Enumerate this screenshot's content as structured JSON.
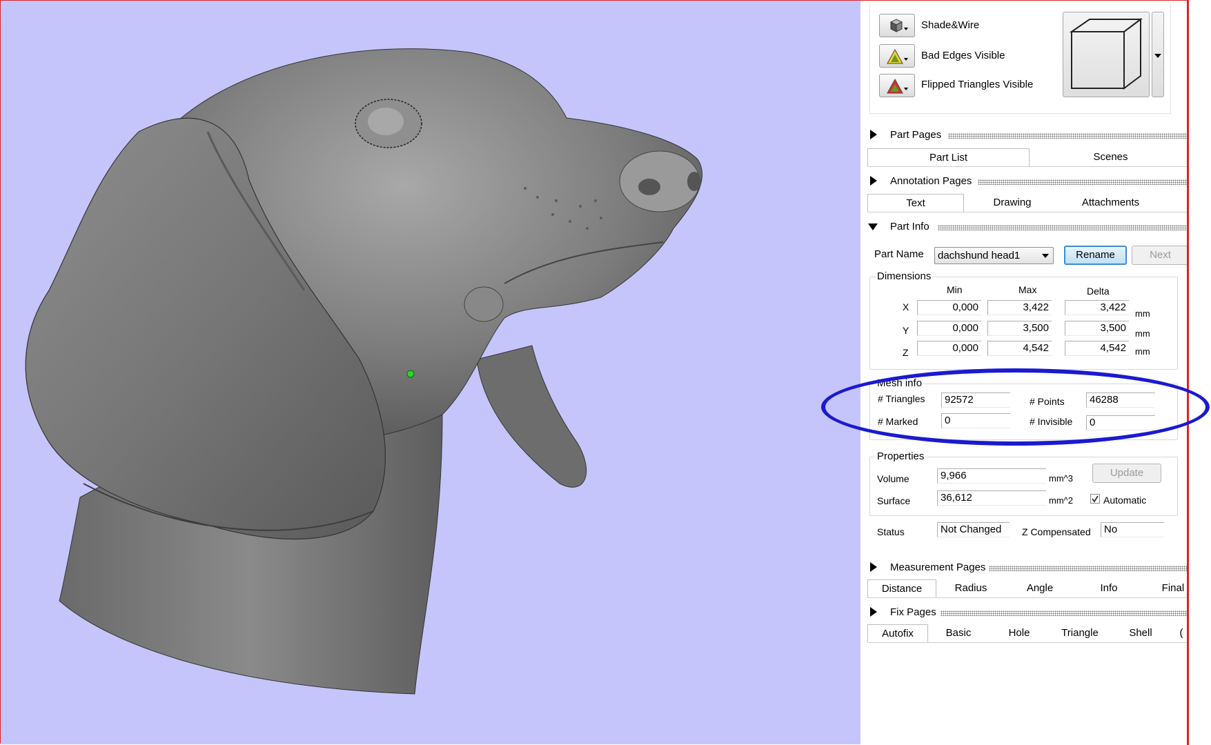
{
  "display": {
    "shade_wire": "Shade&Wire",
    "bad_edges": "Bad Edges Visible",
    "flipped_triangles": "Flipped Triangles Visible"
  },
  "sections": {
    "part_pages": "Part Pages",
    "annotation_pages": "Annotation Pages",
    "part_info": "Part Info",
    "measurement_pages": "Measurement Pages",
    "fix_pages": "Fix Pages"
  },
  "part_tabs": [
    "Part List",
    "Scenes"
  ],
  "annotation_tabs": [
    "Text",
    "Drawing",
    "Attachments"
  ],
  "measurement_tabs": [
    "Distance",
    "Radius",
    "Angle",
    "Info",
    "Final P"
  ],
  "fix_tabs": [
    "Autofix",
    "Basic",
    "Hole",
    "Triangle",
    "Shell",
    "("
  ],
  "part_info": {
    "part_name_label": "Part Name",
    "part_name_value": "dachshund head1",
    "rename": "Rename",
    "next": "Next"
  },
  "dimensions": {
    "label": "Dimensions",
    "col_min": "Min",
    "col_max": "Max",
    "col_delta": "Delta",
    "unit": "mm",
    "rows": [
      {
        "axis": "X",
        "min": "0,000",
        "max": "3,422",
        "delta": "3,422"
      },
      {
        "axis": "Y",
        "min": "0,000",
        "max": "3,500",
        "delta": "3,500"
      },
      {
        "axis": "Z",
        "min": "0,000",
        "max": "4,542",
        "delta": "4,542"
      }
    ]
  },
  "mesh_info": {
    "label": "Mesh info",
    "triangles_label": "# Triangles",
    "triangles": "92572",
    "points_label": "# Points",
    "points": "46288",
    "marked_label": "# Marked",
    "marked": "0",
    "invisible_label": "# Invisible",
    "invisible": "0"
  },
  "properties": {
    "label": "Properties",
    "volume_label": "Volume",
    "volume": "9,966",
    "volume_unit": "mm^3",
    "surface_label": "Surface",
    "surface": "36,612",
    "surface_unit": "mm^2",
    "update": "Update",
    "automatic": "Automatic",
    "automatic_checked": true
  },
  "status": {
    "status_label": "Status",
    "status_value": "Not Changed",
    "zcomp_label": "Z Compensated",
    "zcomp_value": "No"
  },
  "colors": {
    "viewport_bg": "#c5c5fb",
    "highlight": "#1a1ad0",
    "rename_border": "#3c8ad6"
  }
}
